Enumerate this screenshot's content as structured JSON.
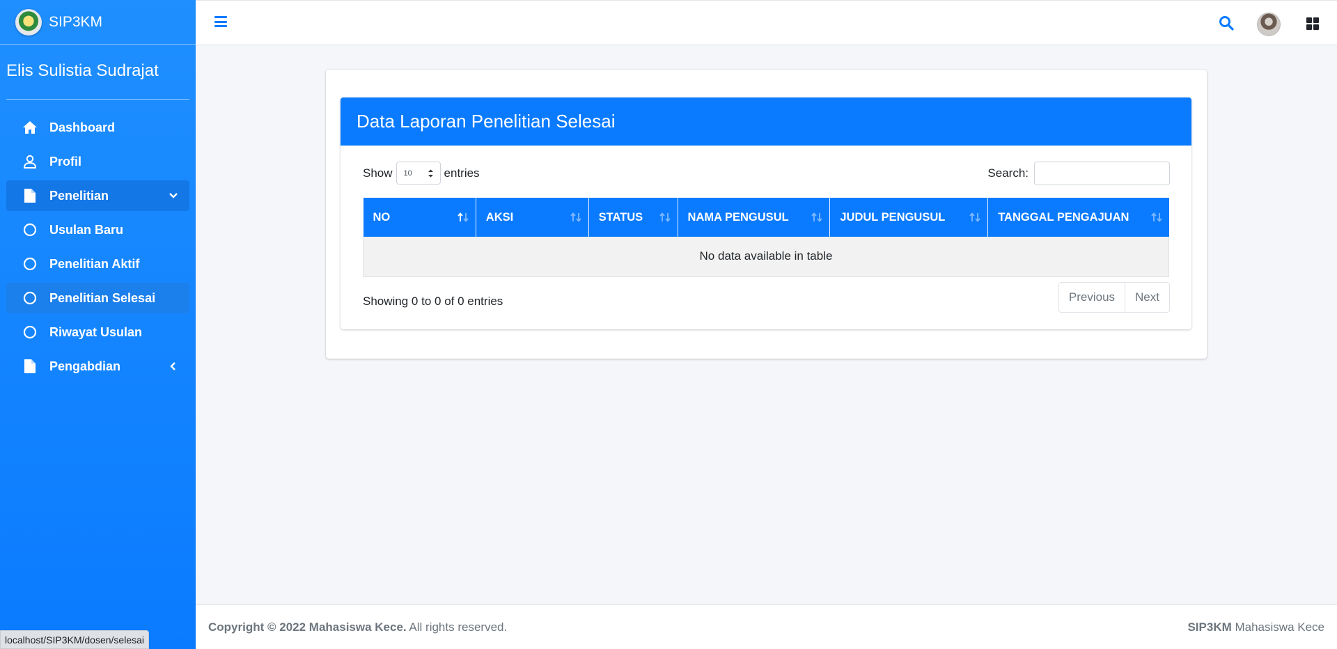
{
  "app": {
    "brand": "SIP3KM"
  },
  "sidebar": {
    "user_name": "Elis Sulistia Sudrajat",
    "items": [
      {
        "label": "Dashboard",
        "icon": "home-icon"
      },
      {
        "label": "Profil",
        "icon": "user-icon"
      },
      {
        "label": "Penelitian",
        "icon": "file-icon",
        "expanded": true
      },
      {
        "label": "Usulan Baru",
        "icon": "circle-icon"
      },
      {
        "label": "Penelitian Aktif",
        "icon": "circle-icon"
      },
      {
        "label": "Penelitian Selesai",
        "icon": "circle-icon",
        "selected": true
      },
      {
        "label": "Riwayat Usulan",
        "icon": "circle-icon"
      },
      {
        "label": "Pengabdian",
        "icon": "file-icon",
        "expanded": false
      }
    ]
  },
  "topbar": {
    "icons": [
      "menu-icon",
      "search-icon",
      "avatar",
      "apps-grid-icon"
    ]
  },
  "card": {
    "title": "Data Laporan Penelitian Selesai",
    "length": {
      "prefix": "Show",
      "value": "10",
      "suffix": "entries"
    },
    "search_label": "Search:",
    "search_value": "",
    "columns": [
      "NO",
      "AKSI",
      "STATUS",
      "NAMA PENGUSUL",
      "JUDUL PENGUSUL",
      "TANGGAL PENGAJUAN"
    ],
    "empty_message": "No data available in table",
    "info": "Showing 0 to 0 of 0 entries",
    "prev_label": "Previous",
    "next_label": "Next"
  },
  "footer": {
    "copyright_bold": "Copyright © 2022 Mahasiswa Kece.",
    "copyright_rest": " All rights reserved.",
    "right_bold": "SIP3KM",
    "right_rest": " Mahasiswa Kece"
  },
  "status_url": "localhost/SIP3KM/dosen/selesai",
  "colors": {
    "primary": "#0a7bff",
    "sidebar": "#1f8fff",
    "background": "#f4f6f9"
  }
}
